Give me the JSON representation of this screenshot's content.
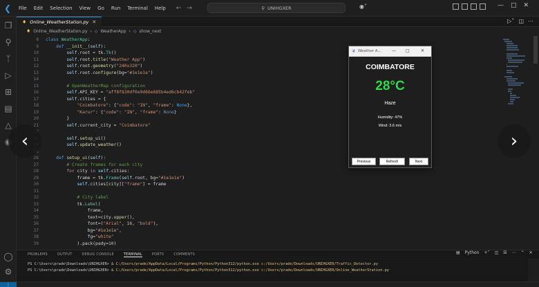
{
  "titlebar": {
    "menus": [
      "File",
      "Edit",
      "Selection",
      "View",
      "Go",
      "Run",
      "Terminal",
      "Help"
    ],
    "search_text": "UNIHGXER"
  },
  "tab": {
    "label": "Online_WeatherStation.py"
  },
  "breadcrumb": {
    "file": "Online_WeatherStation.py",
    "class": "WeatherApp",
    "method": "show_next"
  },
  "code_lines": [
    {
      "n": "8",
      "html": "<span class='kw'>class</span> <span class='cls'>WeatherApp</span>:",
      "indent": 0
    },
    {
      "n": "9",
      "html": "    <span class='kw'>def</span> <span class='fn'>__init__</span>(<span class='self'>self</span>):",
      "indent": 0
    },
    {
      "n": "10",
      "html": "        <span class='self'>self</span>.root = tk.<span class='cls'>Tk</span>()",
      "indent": 0
    },
    {
      "n": "11",
      "html": "        <span class='self'>self</span>.root.<span class='fn'>title</span>(<span class='str'>\"Weather App\"</span>)",
      "indent": 0
    },
    {
      "n": "12",
      "html": "        <span class='self'>self</span>.root.<span class='fn'>geometry</span>(<span class='str'>\"240x320\"</span>)",
      "indent": 0
    },
    {
      "n": "13",
      "html": "        <span class='self'>self</span>.root.<span class='fn'>configure</span>(bg=<span class='str'>\"#1e1e1e\"</span>)",
      "indent": 0
    },
    {
      "n": "14",
      "html": "",
      "indent": 0
    },
    {
      "n": "15",
      "html": "        <span class='cmt'># OpenWeatherMap configuration</span>",
      "indent": 0
    },
    {
      "n": "16",
      "html": "        <span class='self'>self</span>.API_KEY = <span class='str'>\"aff8f830df0e9d66e685b4ed6cb42feb\"</span>",
      "indent": 0
    },
    {
      "n": "17",
      "html": "        <span class='self'>self</span>.cities = {",
      "indent": 0
    },
    {
      "n": "18",
      "html": "            <span class='str'>\"Coimbatore\"</span>: {<span class='str'>\"code\"</span>: <span class='str'>\"IN\"</span>, <span class='str'>\"frame\"</span>: <span class='kw'>None</span>},",
      "indent": 0
    },
    {
      "n": "19",
      "html": "            <span class='str'>\"Karur\"</span>: {<span class='str'>\"code\"</span>: <span class='str'>\"IN\"</span>, <span class='str'>\"frame\"</span>: <span class='kw'>None</span>}",
      "indent": 0
    },
    {
      "n": "20",
      "html": "        }",
      "indent": 0
    },
    {
      "n": "21",
      "html": "        <span class='self'>self</span>.current_city = <span class='str'>\"Coimbatore\"</span>",
      "indent": 0
    },
    {
      "n": "22",
      "html": "",
      "indent": 0
    },
    {
      "n": "23",
      "html": "        <span class='self'>self</span>.<span class='fn'>setup_ui</span>()",
      "indent": 0
    },
    {
      "n": "24",
      "html": "        <span class='self'>self</span>.<span class='fn'>update_weather</span>()",
      "indent": 0
    },
    {
      "n": "25",
      "html": "",
      "indent": 0
    },
    {
      "n": "26",
      "html": "    <span class='kw'>def</span> <span class='fn'>setup_ui</span>(<span class='self'>self</span>):",
      "indent": 0
    },
    {
      "n": "27",
      "html": "        <span class='cmt'># Create frames for each city</span>",
      "indent": 0
    },
    {
      "n": "28",
      "html": "        <span class='kw2'>for</span> city <span class='kw2'>in</span> <span class='self'>self</span>.cities:",
      "indent": 0
    },
    {
      "n": "29",
      "html": "            frame = tk.<span class='cls'>Frame</span>(<span class='self'>self</span>.root, bg=<span class='str'>\"#1e1e1e\"</span>)",
      "indent": 0
    },
    {
      "n": "30",
      "html": "            <span class='self'>self</span>.cities[city][<span class='str'>\"frame\"</span>] = frame",
      "indent": 0
    },
    {
      "n": "31",
      "html": "",
      "indent": 0
    },
    {
      "n": "32",
      "html": "            <span class='cmt'># City label</span>",
      "indent": 0
    },
    {
      "n": "33",
      "html": "            tk.<span class='cls'>Label</span>(",
      "indent": 0
    },
    {
      "n": "34",
      "html": "                frame,",
      "indent": 0
    },
    {
      "n": "35",
      "html": "                text=city.<span class='fn'>upper</span>(),",
      "indent": 0
    },
    {
      "n": "36",
      "html": "                font=(<span class='str'>\"Arial\"</span>, <span class='num'>16</span>, <span class='str'>\"bold\"</span>),",
      "indent": 0
    },
    {
      "n": "37",
      "html": "                bg=<span class='str'>\"#1e1e1e\"</span>,",
      "indent": 0
    },
    {
      "n": "38",
      "html": "                fg=<span class='str'>\"white\"</span>",
      "indent": 0
    },
    {
      "n": "39",
      "html": "            ).<span class='fn'>pack</span>(pady=<span class='num'>10</span>)",
      "indent": 0
    }
  ],
  "weather_app": {
    "title": "Weather A...",
    "city": "COIMBATORE",
    "temperature": "28°C",
    "description": "Haze",
    "humidity": "Humidity: 47%",
    "wind": "Wind: 3.6 m/s",
    "btn_previous": "Previous",
    "btn_refresh": "Refresh",
    "btn_next": "Next"
  },
  "panel": {
    "tabs": [
      "PROBLEMS",
      "OUTPUT",
      "DEBUG CONSOLE",
      "TERMINAL",
      "PORTS",
      "COMMENTS"
    ],
    "active_tab": "TERMINAL",
    "shell": "Python",
    "terminal_lines": [
      {
        "prompt": "PS C:\\Users\\prade\\Downloads\\UNIHGXER> & ",
        "cmd": "C:/Users/prade/AppData/Local/Programs/Python/Python312/python.exe c:/Users/prade/Downloads/UNIHGXER/Traffic_Detector.py"
      },
      {
        "prompt": "PS C:\\Users\\prade\\Downloads\\UNIHGXER> & ",
        "cmd": "C:/Users/prade/AppData/Local/Programs/Python/Python312/python.exe c:/Users/prade/Downloads/UNIHGXER/Online_WeatherStation.py"
      }
    ]
  },
  "colors": {
    "accent": "#3c99dc",
    "temp_green": "#32d74b",
    "editor_bg": "#1e1e1e"
  }
}
